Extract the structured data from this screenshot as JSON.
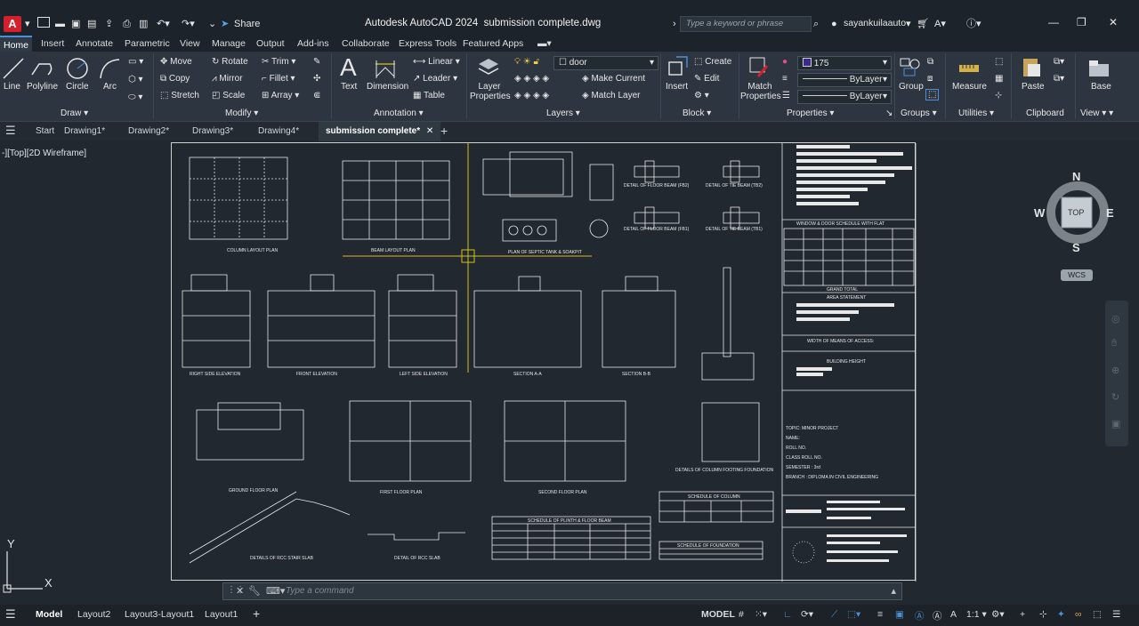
{
  "app": {
    "title": "Autodesk AutoCAD 2024",
    "filename": "submission complete.dwg",
    "logo_letter": "A",
    "share_label": "Share",
    "search_placeholder": "Type a keyword or phrase",
    "username": "sayankuilaauto"
  },
  "menu": [
    "Home",
    "Insert",
    "Annotate",
    "Parametric",
    "View",
    "Manage",
    "Output",
    "Add-ins",
    "Collaborate",
    "Express Tools",
    "Featured Apps"
  ],
  "ribbon": {
    "draw": {
      "label": "Draw",
      "tools": [
        "Line",
        "Polyline",
        "Circle",
        "Arc"
      ]
    },
    "modify": {
      "label": "Modify",
      "tools": [
        "Move",
        "Rotate",
        "Trim",
        "Copy",
        "Mirror",
        "Fillet",
        "Stretch",
        "Scale",
        "Array"
      ]
    },
    "annotation": {
      "label": "Annotation",
      "tools": [
        "Text",
        "Dimension",
        "Linear",
        "Leader",
        "Table"
      ]
    },
    "layers": {
      "label": "Layers",
      "layer_properties": "Layer Properties",
      "current_layer": "door",
      "make_current": "Make Current",
      "match_layer": "Match Layer"
    },
    "block": {
      "label": "Block",
      "insert": "Insert",
      "create": "Create",
      "edit": "Edit"
    },
    "properties": {
      "label": "Properties",
      "match": "Match Properties",
      "color": "175",
      "linetype": "ByLayer",
      "lineweight": "ByLayer"
    },
    "groups": {
      "label": "Groups",
      "group": "Group"
    },
    "utilities": {
      "label": "Utilities",
      "measure": "Measure"
    },
    "clipboard": {
      "label": "Clipboard",
      "paste": "Paste"
    },
    "view": {
      "label": "View",
      "base": "Base"
    }
  },
  "file_tabs": [
    "Start",
    "Drawing1*",
    "Drawing2*",
    "Drawing3*",
    "Drawing4*",
    "submission complete*"
  ],
  "viewport_label": "-][Top][2D Wireframe]",
  "navcube": {
    "n": "N",
    "s": "S",
    "e": "E",
    "w": "W",
    "top": "TOP",
    "wcs": "WCS"
  },
  "ucs": {
    "x": "X",
    "y": "Y"
  },
  "command_placeholder": "Type a command",
  "layout_tabs": [
    "Model",
    "Layout2",
    "Layout3-Layout1",
    "Layout1"
  ],
  "status": {
    "model": "MODEL",
    "scale": "1:1"
  },
  "drawing_captions": {
    "column_layout": "COLUMN LAYOUT PLAN",
    "beam_layout": "BEAM LAYOUT PLAN",
    "septic": "PLAN OF SEPTIC TANK & SOAKPIT",
    "fb2": "DETAIL OF FLOOR BEAM (FB2)",
    "tb2": "DETAIL OF TIE BEAM (TB2)",
    "fb1": "DETAIL OF FLOOR BEAM (FB1)",
    "tb1": "DETAIL OF TIE BEAM (TB1)",
    "right_elev": "RIGHT SIDE ELEVATION",
    "front_elev": "FRONT ELEVATION",
    "left_elev": "LEFT SIDE ELEVATION",
    "section_aa": "SECTION A-A",
    "section_bb": "SECTION B-B",
    "ground_plan": "GROUND FLOOR PLAN",
    "first_plan": "FIRST FLOOR PLAN",
    "second_plan": "SECOND FLOOR PLAN",
    "footing": "DETAILS OF COLUMN FOOTING FOUNDATION",
    "stair": "DETAILS OF RCC STAIR SLAB",
    "rcc_slab": "DETAIL OF RCC SLAB",
    "plinth_sched": "SCHEDULE OF PLINTH & FLOOR BEAM",
    "column_sched": "SCHEDULE OF COLUMN",
    "foundation_sched": "SCHEDULE OF FOUNDATION",
    "window_sched": "WINDOW & DOOR SCHEDULE WITH FLAT",
    "area_stmt": "AREA STATEMENT",
    "means_access": "WIDTH OF MEANS OF ACCESS:",
    "building_height": "BUILDING HEIGHT",
    "grand_total": "GRAND TOTAL",
    "topic": "TOPIC: MINOR PROJECT",
    "name": "NAME:",
    "roll": "ROLL NO.",
    "class_roll": "CLASS ROLL NO.",
    "semester": "SEMESTER : 3rd",
    "branch": "BRANCH : DIPLOMA IN CIVIL ENGINEERING"
  },
  "colors": {
    "accent": "#4a90d9",
    "layer_yellow": "#d4c21a",
    "app_red": "#d4202c"
  }
}
